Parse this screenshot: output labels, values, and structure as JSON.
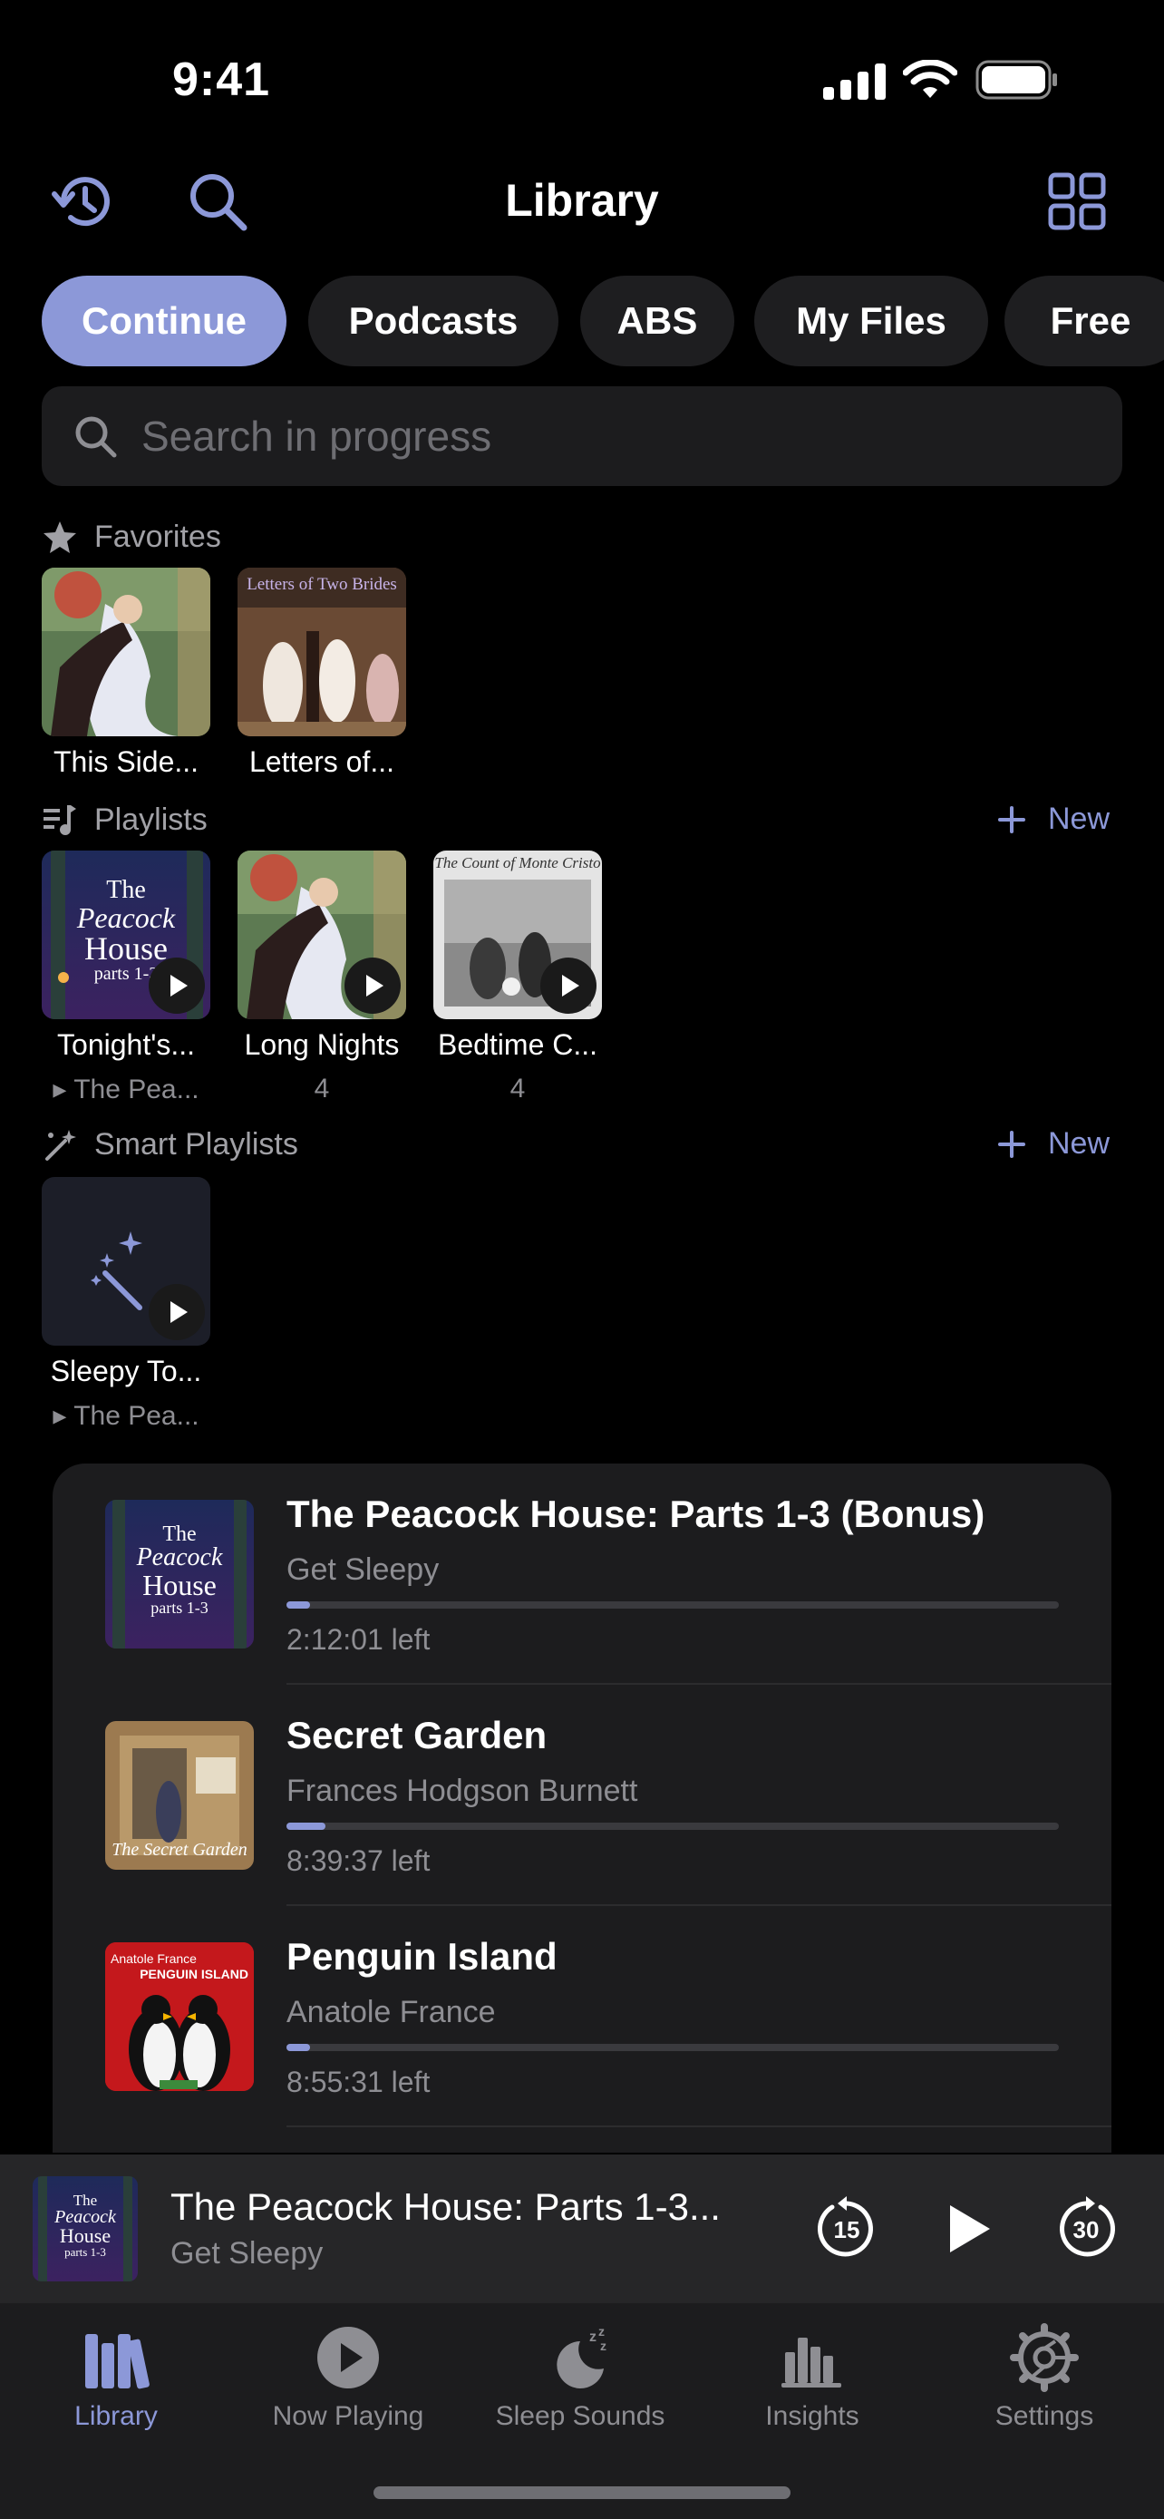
{
  "status": {
    "time": "9:41"
  },
  "header": {
    "title": "Library",
    "history_icon": "history-icon",
    "search_icon": "search-icon",
    "grid_icon": "grid-icon"
  },
  "filters": [
    {
      "label": "Continue",
      "active": true
    },
    {
      "label": "Podcasts",
      "active": false
    },
    {
      "label": "ABS",
      "active": false
    },
    {
      "label": "My Files",
      "active": false
    },
    {
      "label": "Free",
      "active": false
    }
  ],
  "search": {
    "placeholder": "Search in progress"
  },
  "favorites": {
    "title": "Favorites",
    "items": [
      {
        "label": "This Side..."
      },
      {
        "label": "Letters of...",
        "cover_text": "Letters of Two Brides"
      }
    ]
  },
  "playlists": {
    "title": "Playlists",
    "new_label": "New",
    "items": [
      {
        "label": "Tonight's...",
        "sub": "▸ The Pea...",
        "cover_text": [
          "The",
          "Peacock",
          "House",
          "parts 1-3"
        ]
      },
      {
        "label": "Long Nights",
        "sub": "4"
      },
      {
        "label": "Bedtime C...",
        "sub": "4",
        "cover_text": "The Count of Monte Cristo"
      }
    ]
  },
  "smart_playlists": {
    "title": "Smart Playlists",
    "new_label": "New",
    "items": [
      {
        "label": "Sleepy To...",
        "sub": "▸ The Pea..."
      }
    ]
  },
  "continue_list": [
    {
      "title": "The Peacock House: Parts 1-3 (Bonus)",
      "author": "Get Sleepy",
      "progress": 0.03,
      "remaining": "2:12:01 left"
    },
    {
      "title": "Secret Garden",
      "author": "Frances Hodgson Burnett",
      "progress": 0.05,
      "remaining": "8:39:37 left",
      "cover_text": "The Secret Garden"
    },
    {
      "title": "Penguin Island",
      "author": "Anatole France",
      "progress": 0.03,
      "remaining": "8:55:31 left",
      "cover_text": [
        "Anatole France",
        "PENGUIN ISLAND"
      ]
    }
  ],
  "now_playing": {
    "title": "The Peacock House: Parts 1-3...",
    "author": "Get Sleepy",
    "skip_back": "15",
    "skip_forward": "30"
  },
  "tabs": [
    {
      "label": "Library",
      "icon": "library-icon",
      "active": true
    },
    {
      "label": "Now Playing",
      "icon": "play-circle-icon",
      "active": false
    },
    {
      "label": "Sleep Sounds",
      "icon": "moon-zzz-icon",
      "active": false
    },
    {
      "label": "Insights",
      "icon": "bar-chart-icon",
      "active": false
    },
    {
      "label": "Settings",
      "icon": "gear-icon",
      "active": false
    }
  ],
  "colors": {
    "accent": "#8c98d8",
    "background": "#000000",
    "card": "#1c1c1e"
  }
}
